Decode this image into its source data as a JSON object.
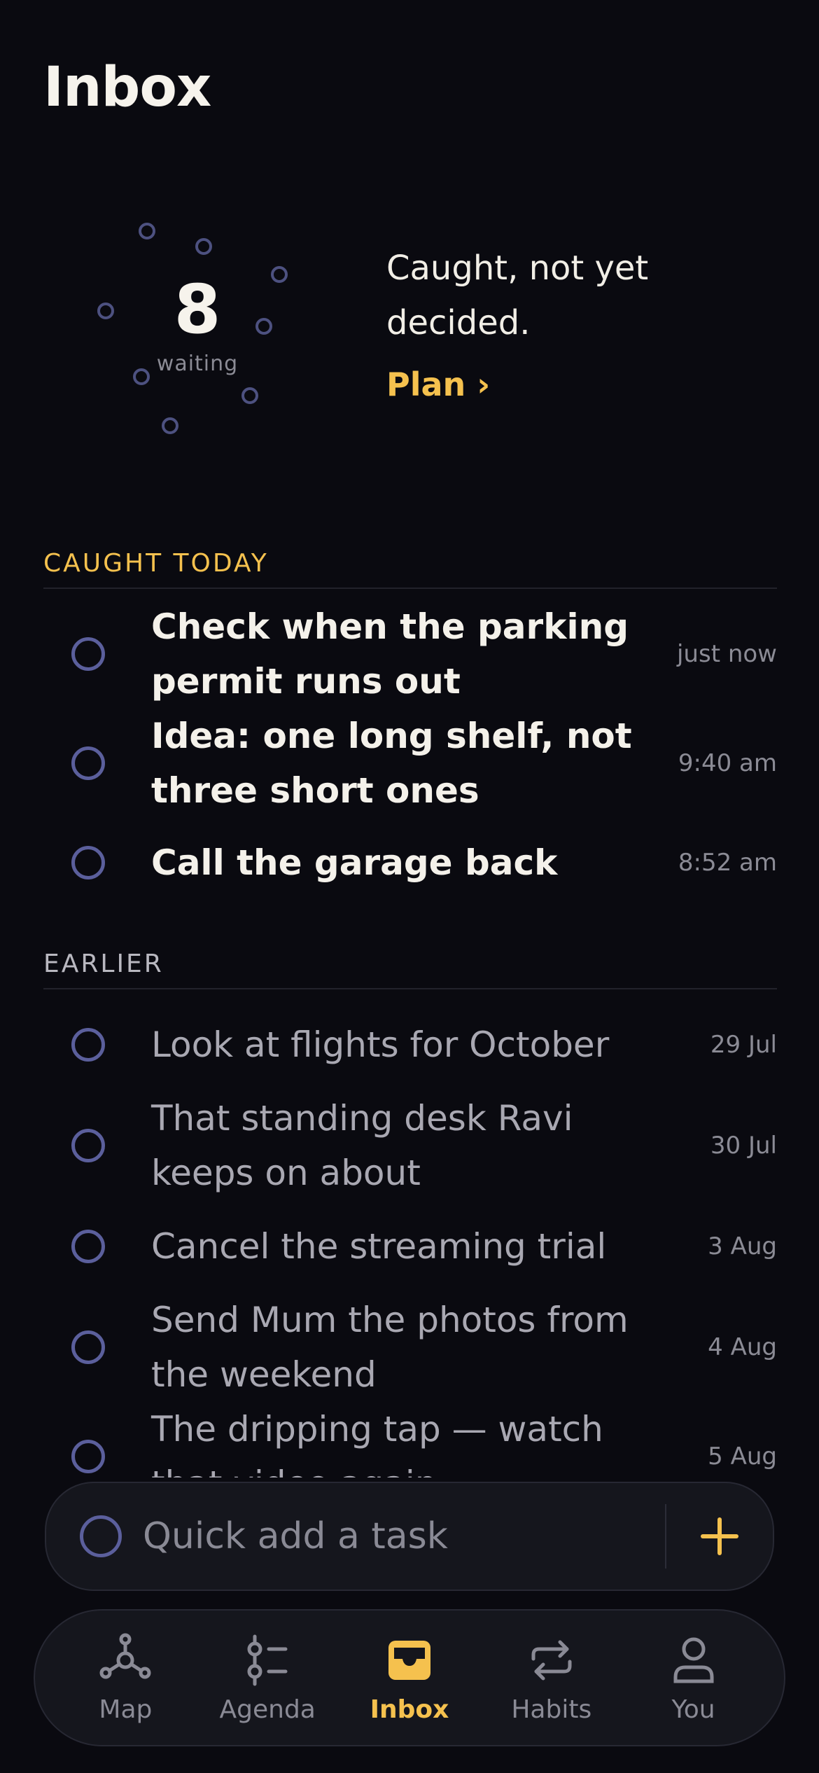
{
  "page": {
    "title": "Inbox"
  },
  "summary": {
    "count": "8",
    "count_label": "waiting",
    "message": "Caught, not yet decided.",
    "action_label": "Plan ›"
  },
  "sections": {
    "today": {
      "heading": "CAUGHT TODAY",
      "tasks": [
        {
          "text": "Check when the parking permit runs out",
          "time": "just now"
        },
        {
          "text": "Idea: one long shelf, not three short ones",
          "time": "9:40 am"
        },
        {
          "text": "Call the garage back",
          "time": "8:52 am"
        }
      ]
    },
    "earlier": {
      "heading": "EARLIER",
      "tasks": [
        {
          "text": "Look at flights for October",
          "time": "29 Jul"
        },
        {
          "text": "That standing desk Ravi keeps on about",
          "time": "30 Jul"
        },
        {
          "text": "Cancel the streaming trial",
          "time": "3 Aug"
        },
        {
          "text": "Send Mum the photos from the weekend",
          "time": "4 Aug"
        },
        {
          "text": "The dripping tap — watch that video again",
          "time": "5 Aug"
        }
      ]
    }
  },
  "quick_add": {
    "placeholder": "Quick add a task",
    "value": "",
    "add_icon": "plus-icon"
  },
  "tabs": [
    {
      "label": "Map",
      "icon": "map-network-icon",
      "active": false
    },
    {
      "label": "Agenda",
      "icon": "agenda-timeline-icon",
      "active": false
    },
    {
      "label": "Inbox",
      "icon": "inbox-tray-icon",
      "active": true
    },
    {
      "label": "Habits",
      "icon": "repeat-arrows-icon",
      "active": false
    },
    {
      "label": "You",
      "icon": "person-icon",
      "active": false
    }
  ],
  "colors": {
    "background": "#0a0a10",
    "accent": "#f5c14e",
    "check_ring": "#5b5f9c",
    "muted_text": "#8b8b95"
  }
}
